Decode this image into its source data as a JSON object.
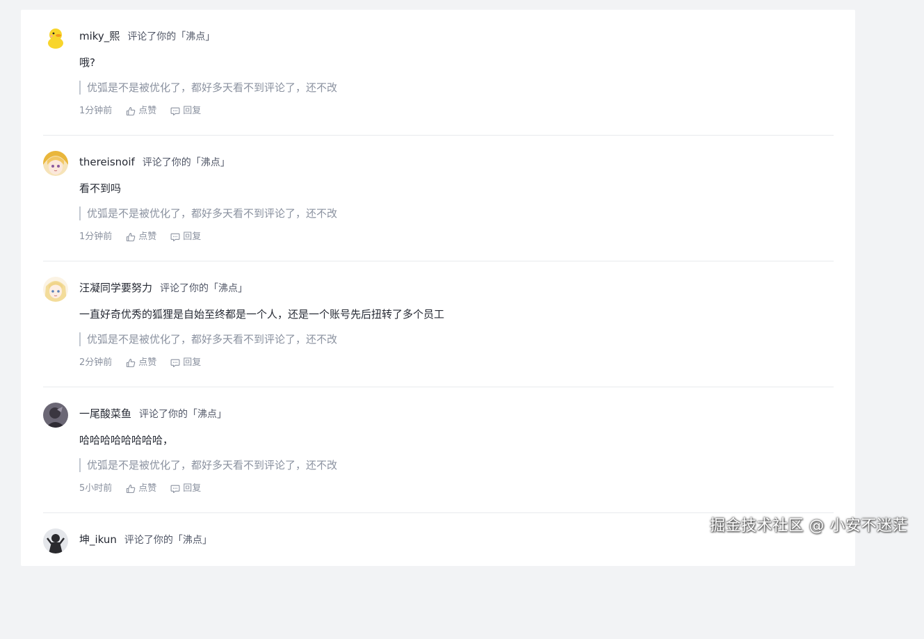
{
  "notifications": [
    {
      "username": "miky_熙",
      "action": "评论了你的「沸点」",
      "content": "哦?",
      "quote": "优弧是不是被优化了，都好多天看不到评论了，还不改",
      "time": "1分钟前",
      "like_label": "点赞",
      "reply_label": "回复",
      "avatar_icon": "yellow-duck-avatar"
    },
    {
      "username": "thereisnoif",
      "action": "评论了你的「沸点」",
      "content": "看不到吗",
      "quote": "优弧是不是被优化了，都好多天看不到评论了，还不改",
      "time": "1分钟前",
      "like_label": "点赞",
      "reply_label": "回复",
      "avatar_icon": "anime-girl-avatar"
    },
    {
      "username": "汪凝同学要努力",
      "action": "评论了你的「沸点」",
      "content": "一直好奇优秀的狐狸是自始至终都是一个人，还是一个账号先后扭转了多个员工",
      "quote": "优弧是不是被优化了，都好多天看不到评论了，还不改",
      "time": "2分钟前",
      "like_label": "点赞",
      "reply_label": "回复",
      "avatar_icon": "blonde-anime-girl-avatar"
    },
    {
      "username": "一尾酸菜鱼",
      "action": "评论了你的「沸点」",
      "content": "哈哈哈哈哈哈哈哈，",
      "quote": "优弧是不是被优化了，都好多天看不到评论了，还不改",
      "time": "5小时前",
      "like_label": "点赞",
      "reply_label": "回复",
      "avatar_icon": "dark-photo-avatar"
    },
    {
      "username": "坤_ikun",
      "action": "评论了你的「沸点」",
      "content": "",
      "quote": "",
      "time": "",
      "like_label": "",
      "reply_label": "",
      "avatar_icon": "ikun-avatar"
    }
  ],
  "watermark": "掘金技术社区 @ 小安不迷茫",
  "colors": {
    "page_bg": "#f2f3f5",
    "card_bg": "#ffffff",
    "text_primary": "#252933",
    "text_secondary": "#515767",
    "text_muted": "#8a919f",
    "divider": "#e8eaed"
  }
}
